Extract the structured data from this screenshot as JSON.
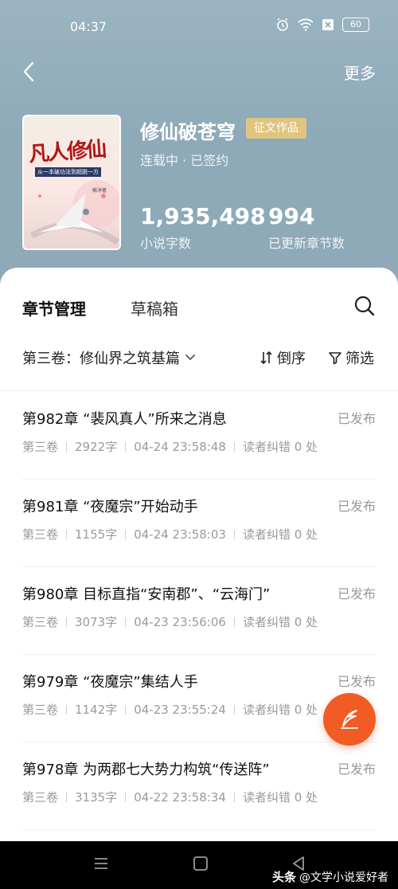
{
  "status_bar": {
    "time": "04:37",
    "battery": "60"
  },
  "topnav": {
    "more_label": "更多"
  },
  "book": {
    "cover_title": "凡人修仙",
    "cover_subtitle": "从一本破功法到超脱一方",
    "cover_author": "蘇淳著",
    "title": "修仙破苍穹",
    "badge": "征文作品",
    "status": "连载中 · 已签约",
    "word_count": "1,935,498",
    "word_count_label": "小说字数",
    "chapter_count": "994",
    "chapter_count_label": "已更新章节数"
  },
  "tabs": [
    {
      "label": "章节管理",
      "active": true
    },
    {
      "label": "草稿箱",
      "active": false
    }
  ],
  "filter_bar": {
    "volume": "第三卷：修仙界之筑基篇",
    "sort_label": "倒序",
    "filter_label": "筛选"
  },
  "chapters": [
    {
      "title": "第982章 “裴风真人”所来之消息",
      "status": "已发布",
      "volume": "第三卷",
      "words": "2922字",
      "time": "04-24 23:58:48",
      "errors": "读者纠错 0 处"
    },
    {
      "title": "第981章 “夜魔宗”开始动手",
      "status": "已发布",
      "volume": "第三卷",
      "words": "1155字",
      "time": "04-24 23:58:03",
      "errors": "读者纠错 0 处"
    },
    {
      "title": "第980章 目标直指“安南郡”、“云海门”",
      "status": "已发布",
      "volume": "第三卷",
      "words": "3073字",
      "time": "04-23 23:56:06",
      "errors": "读者纠错 0 处"
    },
    {
      "title": "第979章 “夜魔宗”集结人手",
      "status": "已发布",
      "volume": "第三卷",
      "words": "1142字",
      "time": "04-23 23:55:24",
      "errors": "读者纠错 0 处"
    },
    {
      "title": "第978章 为两郡七大势力构筑“传送阵”",
      "status": "已发布",
      "volume": "第三卷",
      "words": "3135字",
      "time": "04-22 23:58:34",
      "errors": "读者纠错 0 处"
    }
  ],
  "watermark": {
    "logo": "头条",
    "text": "@文学小说爱好者"
  },
  "colors": {
    "header_bg": "#8fa9b7",
    "badge": "#e0c57f",
    "fab": "#f05c24"
  },
  "icons": {
    "back": "chevron-left-icon",
    "search": "search-icon",
    "sort": "sort-icon",
    "filter": "filter-icon",
    "write": "quill-icon"
  }
}
